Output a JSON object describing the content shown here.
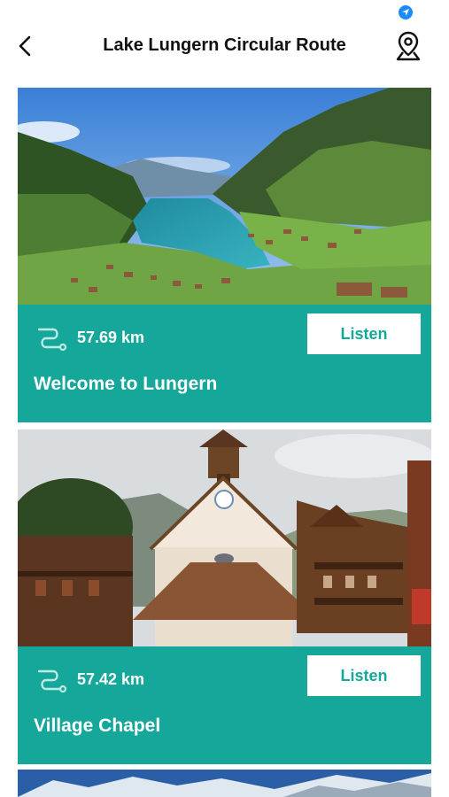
{
  "header": {
    "title": "Lake Lungern Circular Route",
    "back_icon": "chevron-left-icon",
    "map_icon": "map-pin-icon"
  },
  "status": {
    "location_icon": "location-arrow-icon"
  },
  "colors": {
    "accent": "#15a89a",
    "location": "#1a8cff"
  },
  "stops": [
    {
      "distance": "57.69 km",
      "name": "Welcome to Lungern",
      "listen_label": "Listen",
      "image": "lake-valley-photo"
    },
    {
      "distance": "57.42 km",
      "name": "Village Chapel",
      "listen_label": "Listen",
      "image": "chapel-photo"
    }
  ]
}
